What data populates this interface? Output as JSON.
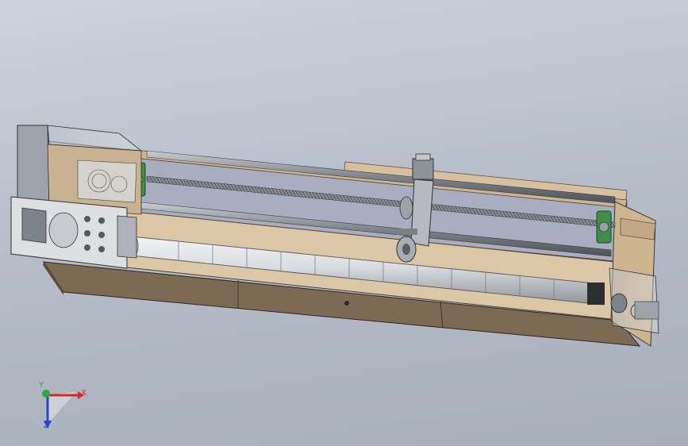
{
  "viewport": {
    "model_name": "",
    "background_top": "#cdd3dc",
    "background_bottom": "#a7aeb9"
  },
  "triad": {
    "x_label": "X",
    "y_label": "Y",
    "z_label": "Z",
    "x_color": "#d62b2b",
    "y_color": "#2faa3b",
    "z_color": "#2b47c8"
  },
  "materials": {
    "wood_panel": "#d9c3a4",
    "frame_dark": "#7d6b55",
    "shaft_gray": "#8e9197",
    "roller_light": "#dadde2",
    "bearing_green": "#3f8f4a"
  }
}
